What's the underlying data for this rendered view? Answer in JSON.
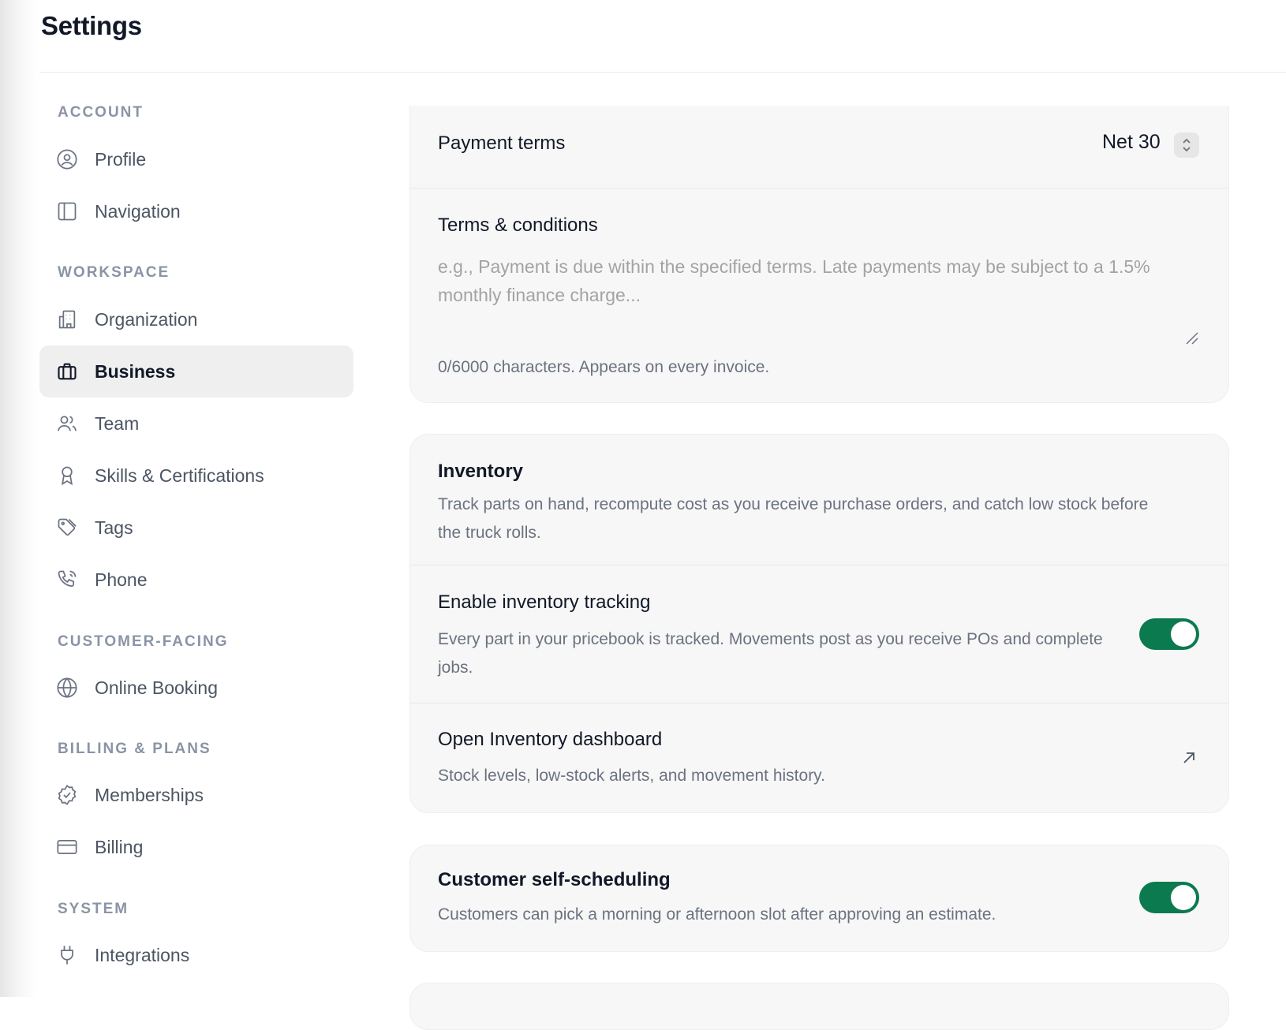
{
  "header": {
    "title": "Settings"
  },
  "sidebar": {
    "sections": [
      {
        "label": "ACCOUNT"
      },
      {
        "label": "WORKSPACE"
      },
      {
        "label": "CUSTOMER-FACING"
      },
      {
        "label": "BILLING & PLANS"
      },
      {
        "label": "SYSTEM"
      }
    ],
    "items": [
      {
        "label": "Profile",
        "icon": "user-circle-icon"
      },
      {
        "label": "Navigation",
        "icon": "sidebar-layout-icon"
      },
      {
        "label": "Organization",
        "icon": "building-icon"
      },
      {
        "label": "Business",
        "icon": "briefcase-icon",
        "active": true
      },
      {
        "label": "Team",
        "icon": "users-icon"
      },
      {
        "label": "Skills & Certifications",
        "icon": "award-icon"
      },
      {
        "label": "Tags",
        "icon": "tags-icon"
      },
      {
        "label": "Phone",
        "icon": "phone-icon"
      },
      {
        "label": "Online Booking",
        "icon": "globe-icon"
      },
      {
        "label": "Memberships",
        "icon": "badge-check-icon"
      },
      {
        "label": "Billing",
        "icon": "credit-card-icon"
      },
      {
        "label": "Integrations",
        "icon": "plug-icon"
      }
    ]
  },
  "payment": {
    "label": "Payment terms",
    "value": "Net 30",
    "terms_label": "Terms & conditions",
    "terms_placeholder": "e.g., Payment is due within the specified terms. Late payments may be subject to a 1.5% monthly finance charge...",
    "terms_hint": "0/6000 characters. Appears on every invoice."
  },
  "inventory": {
    "title": "Inventory",
    "description": "Track parts on hand, recompute cost as you receive purchase orders, and catch low stock before the truck rolls.",
    "tracking_title": "Enable inventory tracking",
    "tracking_desc": "Every part in your pricebook is tracked. Movements post as you receive POs and complete jobs.",
    "tracking_enabled": true,
    "dashboard_title": "Open Inventory dashboard",
    "dashboard_desc": "Stock levels, low-stock alerts, and movement history."
  },
  "scheduling": {
    "title": "Customer self-scheduling",
    "description": "Customers can pick a morning or afternoon slot after approving an estimate.",
    "enabled": true
  },
  "colors": {
    "accent": "#0b7a4f",
    "active_bg": "#efefef"
  }
}
